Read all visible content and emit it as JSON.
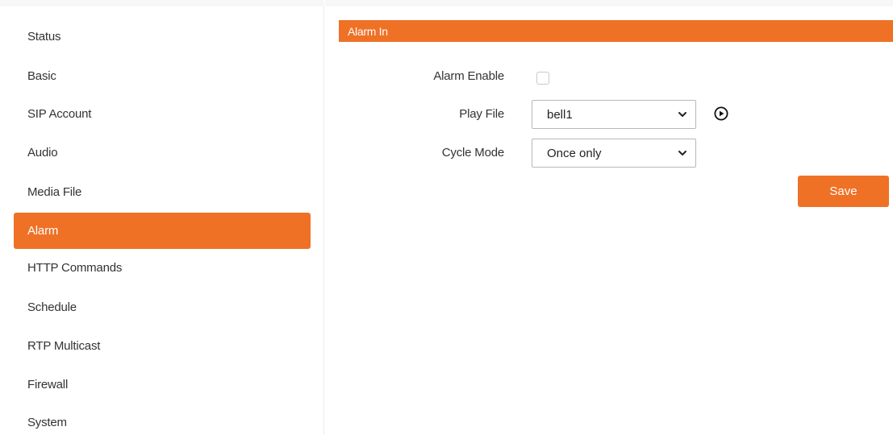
{
  "sidebar": {
    "items": [
      {
        "label": "Status"
      },
      {
        "label": "Basic"
      },
      {
        "label": "SIP Account"
      },
      {
        "label": "Audio"
      },
      {
        "label": "Media File"
      },
      {
        "label": "Alarm",
        "active": true
      },
      {
        "label": "HTTP Commands"
      },
      {
        "label": "Schedule"
      },
      {
        "label": "RTP Multicast"
      },
      {
        "label": "Firewall"
      },
      {
        "label": "System"
      }
    ]
  },
  "section": {
    "title": "Alarm In"
  },
  "form": {
    "alarm_enable": {
      "label": "Alarm Enable",
      "checked": false
    },
    "play_file": {
      "label": "Play File",
      "value": "bell1",
      "play_icon": "play-circle-icon"
    },
    "cycle_mode": {
      "label": "Cycle Mode",
      "value": "Once only"
    }
  },
  "actions": {
    "save_label": "Save"
  },
  "colors": {
    "accent": "#ef7126",
    "text": "#333333",
    "border": "#b8b8b8"
  }
}
